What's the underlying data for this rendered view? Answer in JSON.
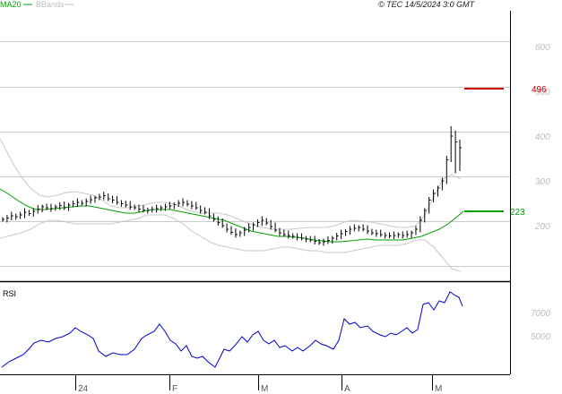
{
  "header": {
    "legend": [
      {
        "label": "MA20",
        "color": "#00a000"
      },
      {
        "label": "BBands",
        "color": "#bdbdbd"
      }
    ],
    "copyright": "© TEC 14/5/2024 3:0 GMT"
  },
  "chart_data": [
    {
      "type": "candlestick",
      "yticks": [
        "600",
        "500",
        "400",
        "300",
        "200"
      ],
      "ylim": [
        150,
        680
      ],
      "xticks": [
        "24",
        "F",
        "M",
        "A",
        "M"
      ],
      "levels": [
        {
          "label": "496",
          "value": 496,
          "color": "#cc0000"
        },
        {
          "label": "223",
          "value": 223,
          "color": "#00a000"
        }
      ],
      "series_close": [
        212,
        215,
        220,
        218,
        222,
        228,
        225,
        230,
        235,
        240,
        238,
        236,
        240,
        243,
        238,
        244,
        247,
        250,
        248,
        252,
        256,
        260,
        262,
        265,
        258,
        255,
        250,
        247,
        244,
        240,
        238,
        235,
        233,
        232,
        234,
        236,
        238,
        240,
        242,
        245,
        248,
        250,
        246,
        242,
        238,
        232,
        228,
        220,
        212,
        205,
        198,
        190,
        183,
        178,
        182,
        188,
        194,
        200,
        205,
        210,
        204,
        196,
        188,
        182,
        178,
        176,
        174,
        172,
        170,
        168,
        166,
        163,
        160,
        162,
        165,
        170,
        175,
        180,
        185,
        190,
        192,
        194,
        190,
        186,
        182,
        180,
        178,
        176,
        175,
        176,
        178,
        176,
        178,
        182,
        190,
        210,
        232,
        255,
        270,
        282,
        298,
        345,
        398,
        385,
        372
      ],
      "highs": [
        420,
        410
      ],
      "lows": [
        315,
        320
      ]
    },
    {
      "type": "line",
      "name": "RSI",
      "ylabel": "RSI",
      "yticks": [
        "7000",
        "5000"
      ],
      "ylim": [
        0,
        100
      ]
    }
  ]
}
